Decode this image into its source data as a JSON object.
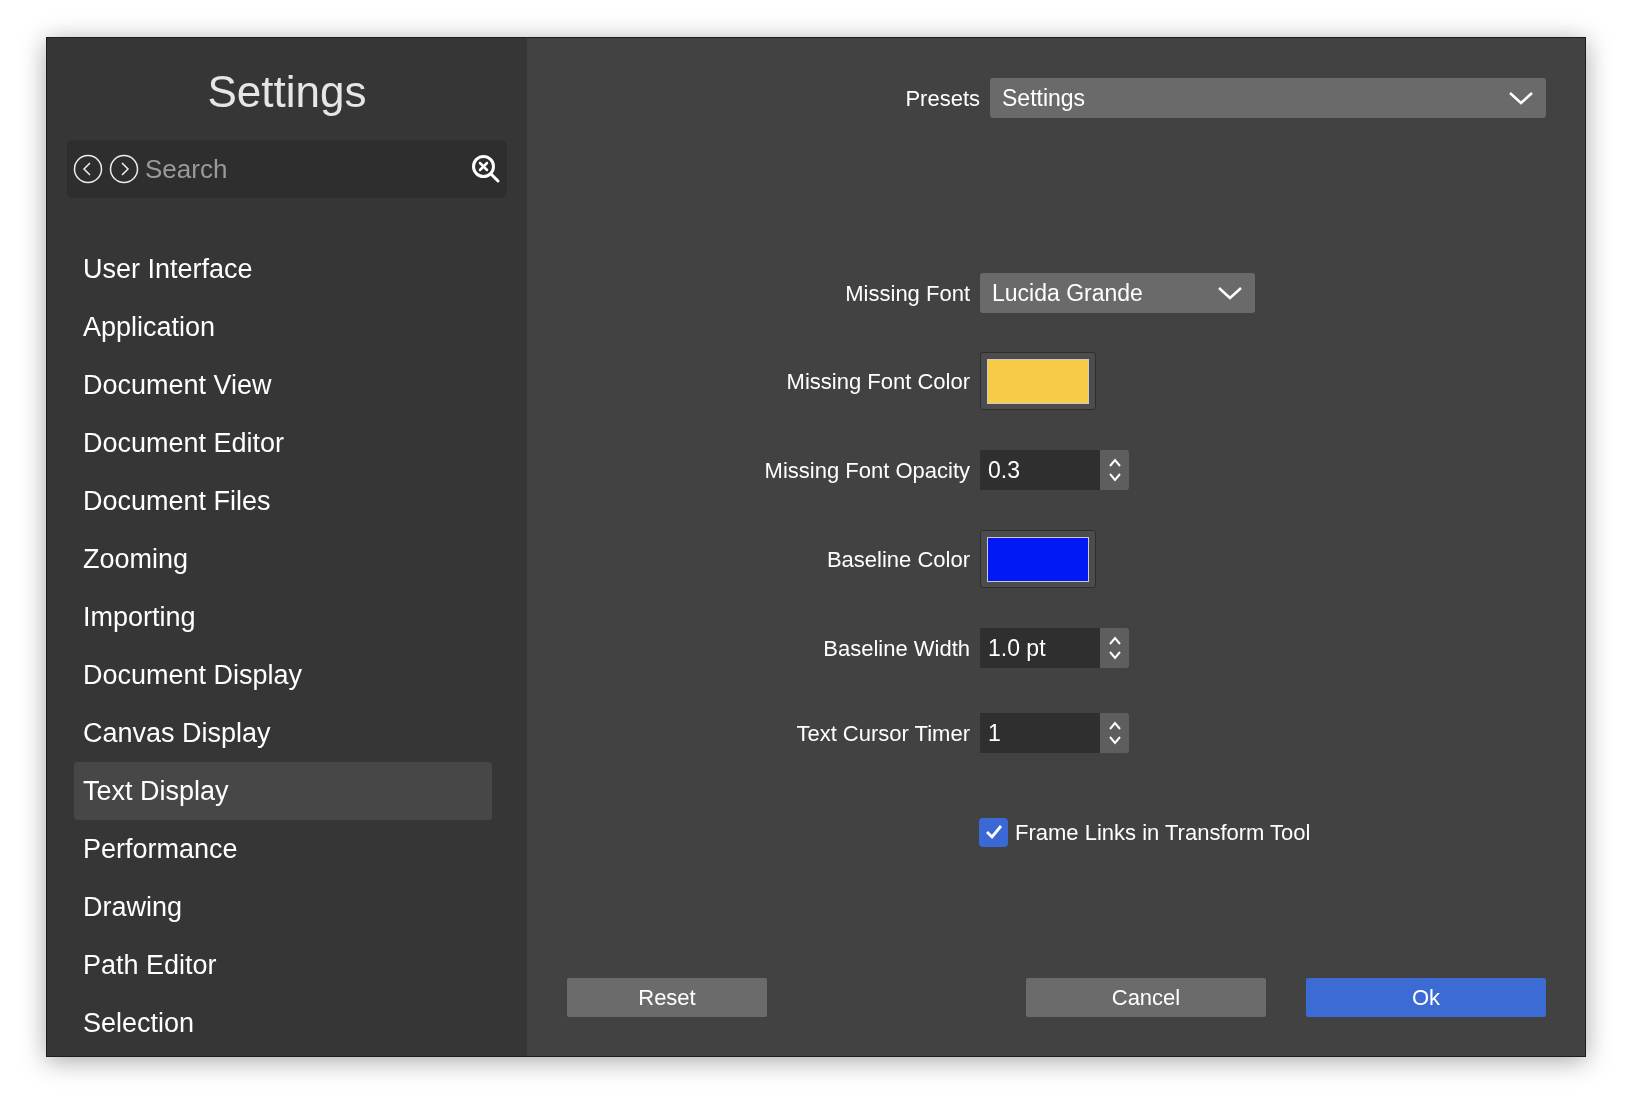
{
  "sidebar": {
    "title": "Settings",
    "search": {
      "placeholder": "Search"
    },
    "items": [
      {
        "label": "User Interface",
        "selected": false
      },
      {
        "label": "Application",
        "selected": false
      },
      {
        "label": "Document View",
        "selected": false
      },
      {
        "label": "Document Editor",
        "selected": false
      },
      {
        "label": "Document Files",
        "selected": false
      },
      {
        "label": "Zooming",
        "selected": false
      },
      {
        "label": "Importing",
        "selected": false
      },
      {
        "label": "Document Display",
        "selected": false
      },
      {
        "label": "Canvas Display",
        "selected": false
      },
      {
        "label": "Text Display",
        "selected": true
      },
      {
        "label": "Performance",
        "selected": false
      },
      {
        "label": "Drawing",
        "selected": false
      },
      {
        "label": "Path Editor",
        "selected": false
      },
      {
        "label": "Selection",
        "selected": false
      }
    ]
  },
  "presets": {
    "label": "Presets",
    "value": "Settings"
  },
  "fields": [
    {
      "kind": "dropdown",
      "label": "Missing Font",
      "value": "Lucida Grande"
    },
    {
      "kind": "color",
      "label": "Missing Font Color",
      "color": "#f7cb48"
    },
    {
      "kind": "stepper",
      "label": "Missing Font Opacity",
      "value": "0.3"
    },
    {
      "kind": "color",
      "label": "Baseline Color",
      "color": "#0019f5"
    },
    {
      "kind": "stepper",
      "label": "Baseline Width",
      "value": "1.0 pt"
    },
    {
      "kind": "stepper",
      "label": "Text Cursor Timer",
      "value": "1"
    },
    {
      "kind": "checkbox",
      "label": "Frame Links in Transform Tool",
      "checked": true
    }
  ],
  "buttons": [
    {
      "label": "Reset",
      "kind": "plain"
    },
    {
      "label": "Cancel",
      "kind": "plain"
    },
    {
      "label": "Ok",
      "kind": "primary"
    }
  ]
}
